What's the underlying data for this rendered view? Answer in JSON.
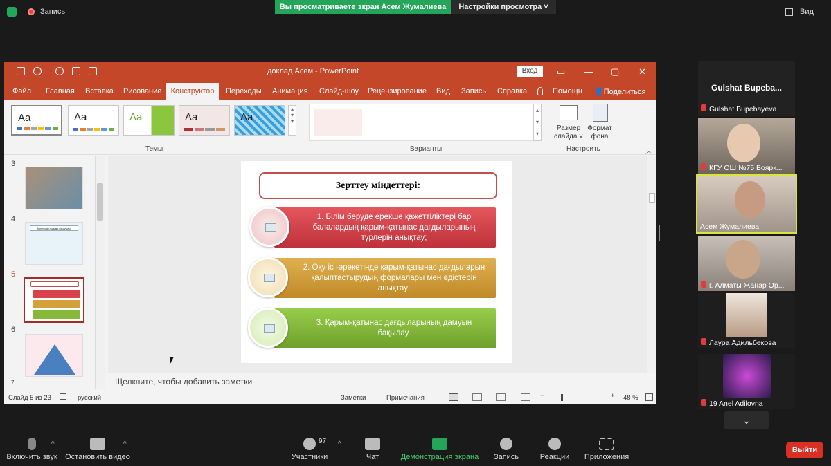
{
  "zoom": {
    "record_label": "Запись",
    "share_banner": "Вы просматриваете экран Асем Жумалиева",
    "view_settings": "Настройки просмотра ˅",
    "view_label": "Вид"
  },
  "ppt": {
    "doc_title": "доклад Асем  -  PowerPoint",
    "signin": "Вход",
    "tabs": [
      "Файл",
      "Главная",
      "Вставка",
      "Рисование",
      "Конструктор",
      "Переходы",
      "Анимация",
      "Слайд-шоу",
      "Рецензирование",
      "Вид",
      "Запись",
      "Справка",
      "Помощн",
      "Поделиться"
    ],
    "groups": {
      "themes": "Темы",
      "variants": "Варианты",
      "customize": "Настроить"
    },
    "slide_size": "Размер слайда ˅",
    "format_bg": "Формат фона",
    "theme_glyph": "Aa",
    "thumb_numbers": [
      "3",
      "4",
      "5",
      "6",
      "7"
    ],
    "thumb4_title": "Зерттеудің ғылыми жаңалығы:",
    "notes_placeholder": "Щелкните, чтобы добавить заметки",
    "status": {
      "slide_info": "Слайд 5 из 23",
      "language": "русский",
      "notes": "Заметки",
      "comments": "Примечания",
      "zoom": "48 %"
    }
  },
  "slide": {
    "title": "Зерттеу міндеттері:",
    "tasks": [
      "1. Білім беруде ерекше қажеттіліктері бар балалардың қарым-қатынас дағдыларының түрлерін анықтау;",
      "2. Оқу іс -әрекетінде қарым-қатынас дағдыларын қалыптастырудың формалары мен әдістерін анықтау;",
      "3. Қарым-қатынас дағдыларының дамуын бақылау."
    ]
  },
  "participants": {
    "header": "Gulshat  Bupeba...",
    "names": [
      "Gulshat Bupebayeva",
      "КГУ ОШ №75 Боярк...",
      "Асем Жумалиева",
      "г. Алматы Жанар Ор...",
      "Лаура Адильбекова",
      "19 Anel Adilovna"
    ]
  },
  "bottom": {
    "mic": "Включить звук",
    "video": "Остановить видео",
    "participants": "Участники",
    "participants_count": "97",
    "chat": "Чат",
    "share": "Демонстрация экрана",
    "record": "Запись",
    "reactions": "Реакции",
    "apps": "Приложения",
    "leave": "Выйти"
  },
  "colors": {
    "ppt_red": "#c4472a",
    "share_green": "#23a55a",
    "task1": "#d9424a",
    "task2": "#d4a03a",
    "task3": "#86b83a",
    "leave": "#d93025"
  }
}
